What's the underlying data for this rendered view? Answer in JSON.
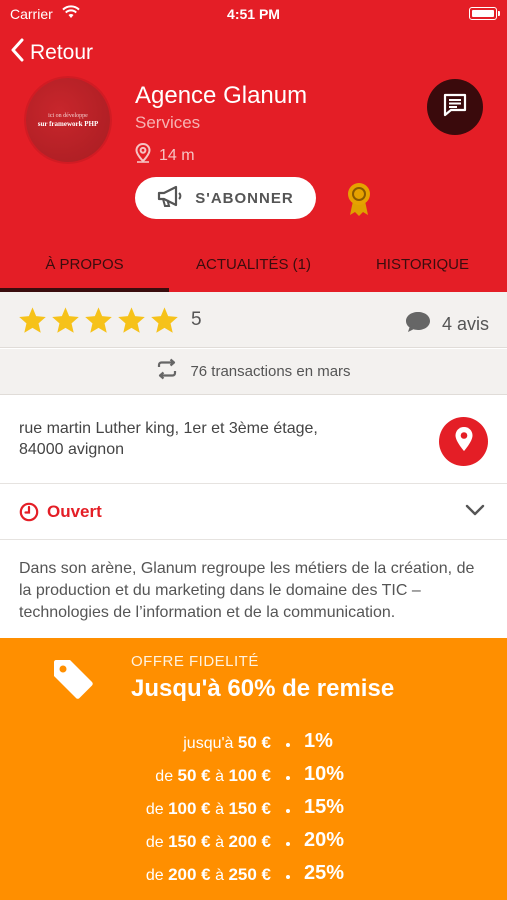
{
  "status_bar": {
    "carrier": "Carrier",
    "time": "4:51 PM"
  },
  "nav": {
    "back_label": "Retour"
  },
  "profile": {
    "name": "Agence Glanum",
    "category": "Services",
    "distance": "14 m",
    "logo_line1": "ici on développe",
    "logo_line2": "sur framework PHP",
    "subscribe_label": "S'ABONNER"
  },
  "tabs": [
    {
      "label": "À PROPOS",
      "active": true
    },
    {
      "label": "ACTUALITÉS (1)",
      "active": false
    },
    {
      "label": "HISTORIQUE",
      "active": false
    }
  ],
  "rating": {
    "stars": 5,
    "value": "5",
    "reviews_label": "4 avis"
  },
  "transactions": {
    "label": "76 transactions en mars"
  },
  "address": {
    "line1": "rue martin Luther king, 1er et 3ème étage,",
    "line2": "84000 avignon"
  },
  "hours": {
    "status": "Ouvert"
  },
  "description": "Dans son arène, Glanum regroupe les métiers de la création, de la production et du marketing dans le domaine des TIC – technologies de l’information et de la communication.",
  "offer": {
    "kicker": "OFFRE FIDELITÉ",
    "title": "Jusqu'à 60% de remise",
    "tiers": [
      {
        "prefix": "jusqu'à",
        "from": "50 €",
        "mid": "",
        "to": "",
        "pct": "1%"
      },
      {
        "prefix": "de",
        "from": "50 €",
        "mid": "à",
        "to": "100 €",
        "pct": "10%"
      },
      {
        "prefix": "de",
        "from": "100 €",
        "mid": "à",
        "to": "150 €",
        "pct": "15%"
      },
      {
        "prefix": "de",
        "from": "150 €",
        "mid": "à",
        "to": "200 €",
        "pct": "20%"
      },
      {
        "prefix": "de",
        "from": "200 €",
        "mid": "à",
        "to": "250 €",
        "pct": "25%"
      }
    ]
  },
  "colors": {
    "brand_red": "#e41e26",
    "offer_orange": "#ff8f00",
    "star_yellow": "#f6c21a",
    "dark_tab": "#3a0d0e"
  }
}
